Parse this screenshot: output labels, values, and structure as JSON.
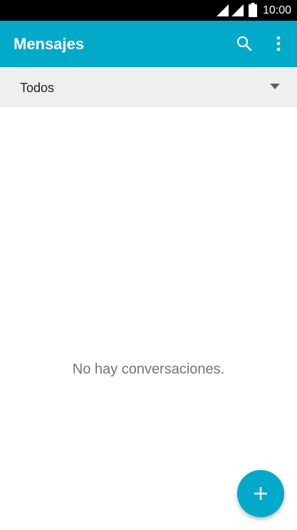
{
  "status_bar": {
    "time": "10:00",
    "icons": [
      "signal-icon",
      "signal-icon",
      "battery-icon"
    ]
  },
  "app_bar": {
    "title": "Mensajes",
    "actions": [
      "search-icon",
      "more-vert-icon"
    ]
  },
  "filter": {
    "selected": "Todos"
  },
  "empty_state": {
    "message": "No hay conversaciones."
  },
  "fab": {
    "icon": "plus-icon"
  },
  "colors": {
    "accent": "#00aac8",
    "status_bar": "#000000",
    "filter_bg": "#efefef",
    "empty_text": "#757575"
  }
}
